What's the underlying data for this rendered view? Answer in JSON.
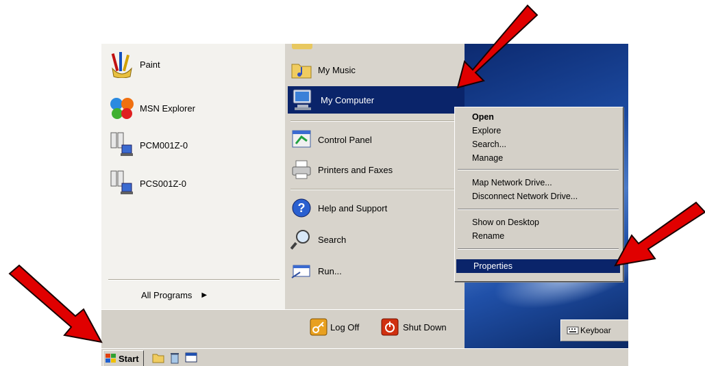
{
  "start_menu": {
    "left_items": [
      {
        "label": "Paint",
        "icon": "paint-icon"
      },
      {
        "label": "MSN Explorer",
        "icon": "msn-butterfly-icon"
      },
      {
        "label": "PCM001Z-0",
        "icon": "network-computer-icon"
      },
      {
        "label": "PCS001Z-0",
        "icon": "network-computer-icon"
      }
    ],
    "all_programs_label": "All Programs",
    "right_items": [
      {
        "label": "My Music",
        "icon": "music-folder-icon"
      },
      {
        "label": "My Computer",
        "icon": "computer-icon"
      },
      {
        "label": "Control Panel",
        "icon": "control-panel-icon"
      },
      {
        "label": "Printers and Faxes",
        "icon": "printer-icon"
      },
      {
        "label": "Help and Support",
        "icon": "help-icon"
      },
      {
        "label": "Search",
        "icon": "search-icon"
      },
      {
        "label": "Run...",
        "icon": "run-icon"
      }
    ],
    "log_off_label": "Log Off",
    "shut_down_label": "Shut Down"
  },
  "context_menu": {
    "items": [
      {
        "label": "Open"
      },
      {
        "label": "Explore"
      },
      {
        "label": "Search..."
      },
      {
        "label": "Manage"
      },
      {
        "label": "Map Network Drive..."
      },
      {
        "label": "Disconnect Network Drive..."
      },
      {
        "label": "Show on Desktop"
      },
      {
        "label": "Rename"
      },
      {
        "label": "Properties"
      }
    ]
  },
  "taskbar": {
    "start_label": "Start",
    "tray_label": "Keyboar"
  },
  "colors": {
    "highlight": "#0a246a",
    "annotation_arrow": "#e00000"
  }
}
